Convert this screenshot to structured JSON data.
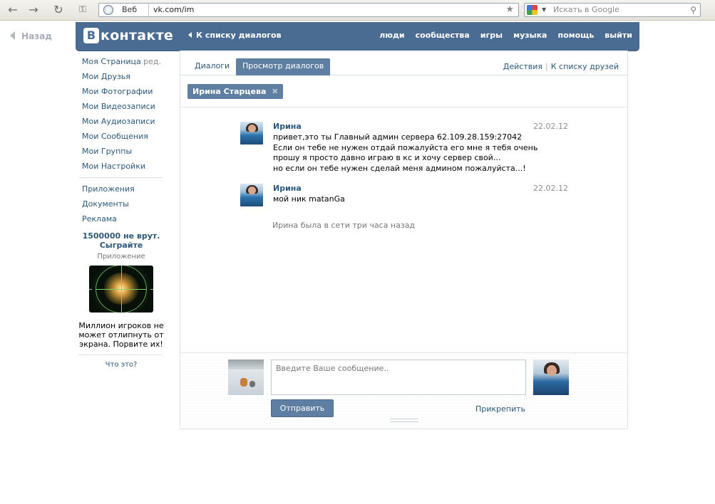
{
  "browser": {
    "search_tag": "Веб",
    "url": "vk.com/im",
    "search_placeholder": "Искать в Google"
  },
  "back_link": "Назад",
  "header": {
    "logo_letter": "В",
    "logo_word": "контакте",
    "back_to_list": "К списку диалогов",
    "nav": [
      "люди",
      "сообщества",
      "игры",
      "музыка",
      "помощь",
      "выйти"
    ]
  },
  "sidebar": {
    "edit_label": "ред.",
    "items_primary": [
      "Моя Страница",
      "Мои Друзья",
      "Мои Фотографии",
      "Мои Видеозаписи",
      "Мои Аудиозаписи",
      "Мои Сообщения",
      "Мои Группы",
      "Мои Настройки"
    ],
    "items_secondary": [
      "Приложения",
      "Документы",
      "Реклама"
    ],
    "ad": {
      "title": "1500000 не врут. Сыграйте",
      "subtitle": "Приложение",
      "text": "Миллион игроков не может отлипнуть от экрана. Порвите их!",
      "what_is_this": "Что это?"
    }
  },
  "tabs": {
    "items": [
      "Диалоги",
      "Просмотр диалогов"
    ],
    "active": "Просмотр диалогов",
    "actions": "Действия",
    "friends_list": "К списку друзей"
  },
  "conversation": {
    "participant": "Ирина Старцева",
    "remove_symbol": "✖",
    "messages": [
      {
        "author": "Ирина",
        "date": "22.02.12",
        "lines": [
          "привет,это ты Главный админ сервера 62.109.28.159:27042",
          "Если он тебе не нужен отдай пожалуйста его мне я тебя очень",
          "прошу я просто давно играю в кс и хочу сервер свой...",
          "но если он тебе нужен сделай меня админом пожалуйста...!"
        ]
      },
      {
        "author": "Ирина",
        "date": "22.02.12",
        "lines": [
          "мой ник matanGa"
        ]
      }
    ],
    "online_status": "Ирина была в сети три часа назад"
  },
  "compose": {
    "placeholder": "Введите Ваше сообщение..",
    "send_label": "Отправить",
    "attach_label": "Прикрепить"
  },
  "colors": {
    "brand": "#4b6c92",
    "link": "#2b587a",
    "button": "#5f7fa2"
  }
}
